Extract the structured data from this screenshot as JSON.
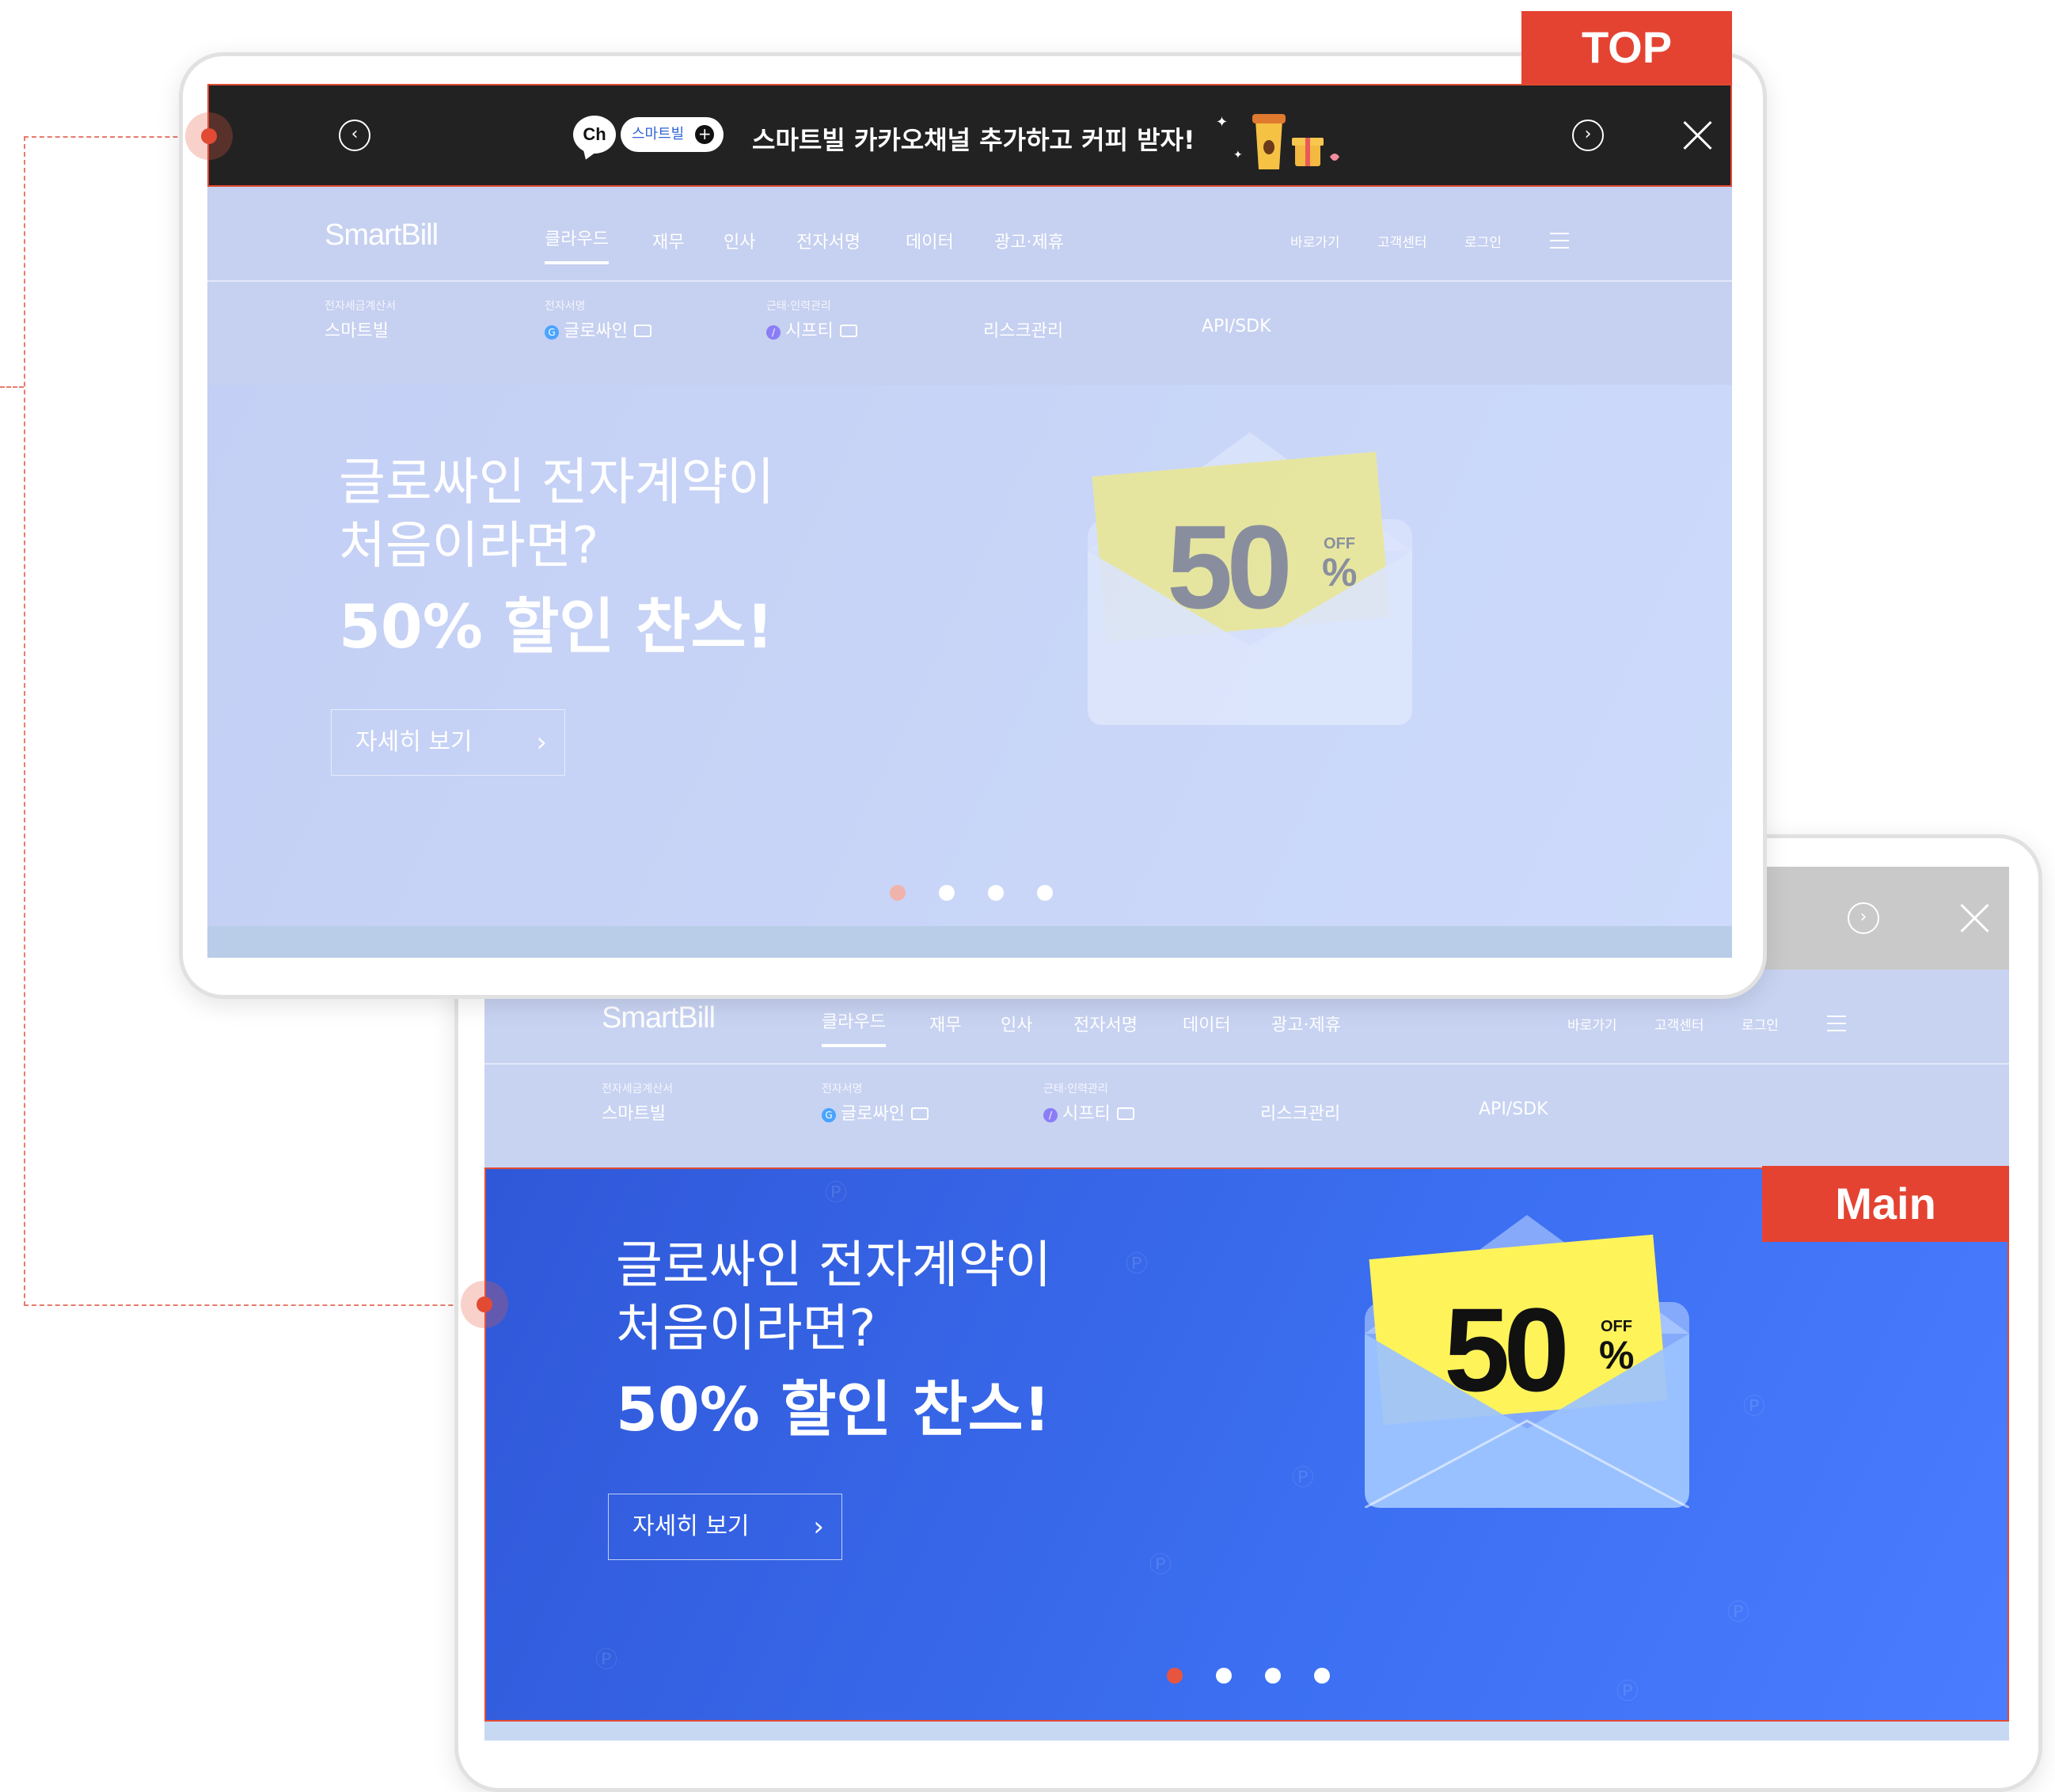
{
  "labels": {
    "top": "TOP",
    "main": "Main"
  },
  "banner": {
    "channel_icon": "Ch",
    "pill_label": "스마트빌",
    "pill_plus": "+",
    "text": "스마트빌 카카오채널 추가하고 커피 받자!",
    "prev_icon": "chevron-left-icon",
    "next_icon": "chevron-right-icon",
    "close_icon": "close-icon"
  },
  "header": {
    "logo": "SmartBill",
    "nav": [
      "클라우드",
      "재무",
      "인사",
      "전자서명",
      "데이터",
      "광고·제휴"
    ],
    "util": [
      "바로가기",
      "고객센터",
      "로그인"
    ],
    "menu_icon": "hamburger-icon"
  },
  "subnav": [
    {
      "small": "전자세금계산서",
      "big": "스마트빌"
    },
    {
      "small": "전자서명",
      "big": "글로싸인"
    },
    {
      "small": "근태·인력관리",
      "big": "시프티"
    },
    {
      "small": "",
      "big": "리스크관리"
    },
    {
      "small": "",
      "big": "API/SDK"
    }
  ],
  "hero": {
    "line1": "글로싸인 전자계약이",
    "line2": "처음이라면?",
    "line3": "50% 할인 찬스!",
    "button": "자세히 보기",
    "button_chevron": "›",
    "coupon_number": "50",
    "coupon_off": "OFF",
    "coupon_pct": "%"
  },
  "colors": {
    "accent": "#e44332",
    "hero_blue": "#3a6cf0",
    "hero_faded": "#c6d3f6",
    "banner_bg": "#222222"
  }
}
